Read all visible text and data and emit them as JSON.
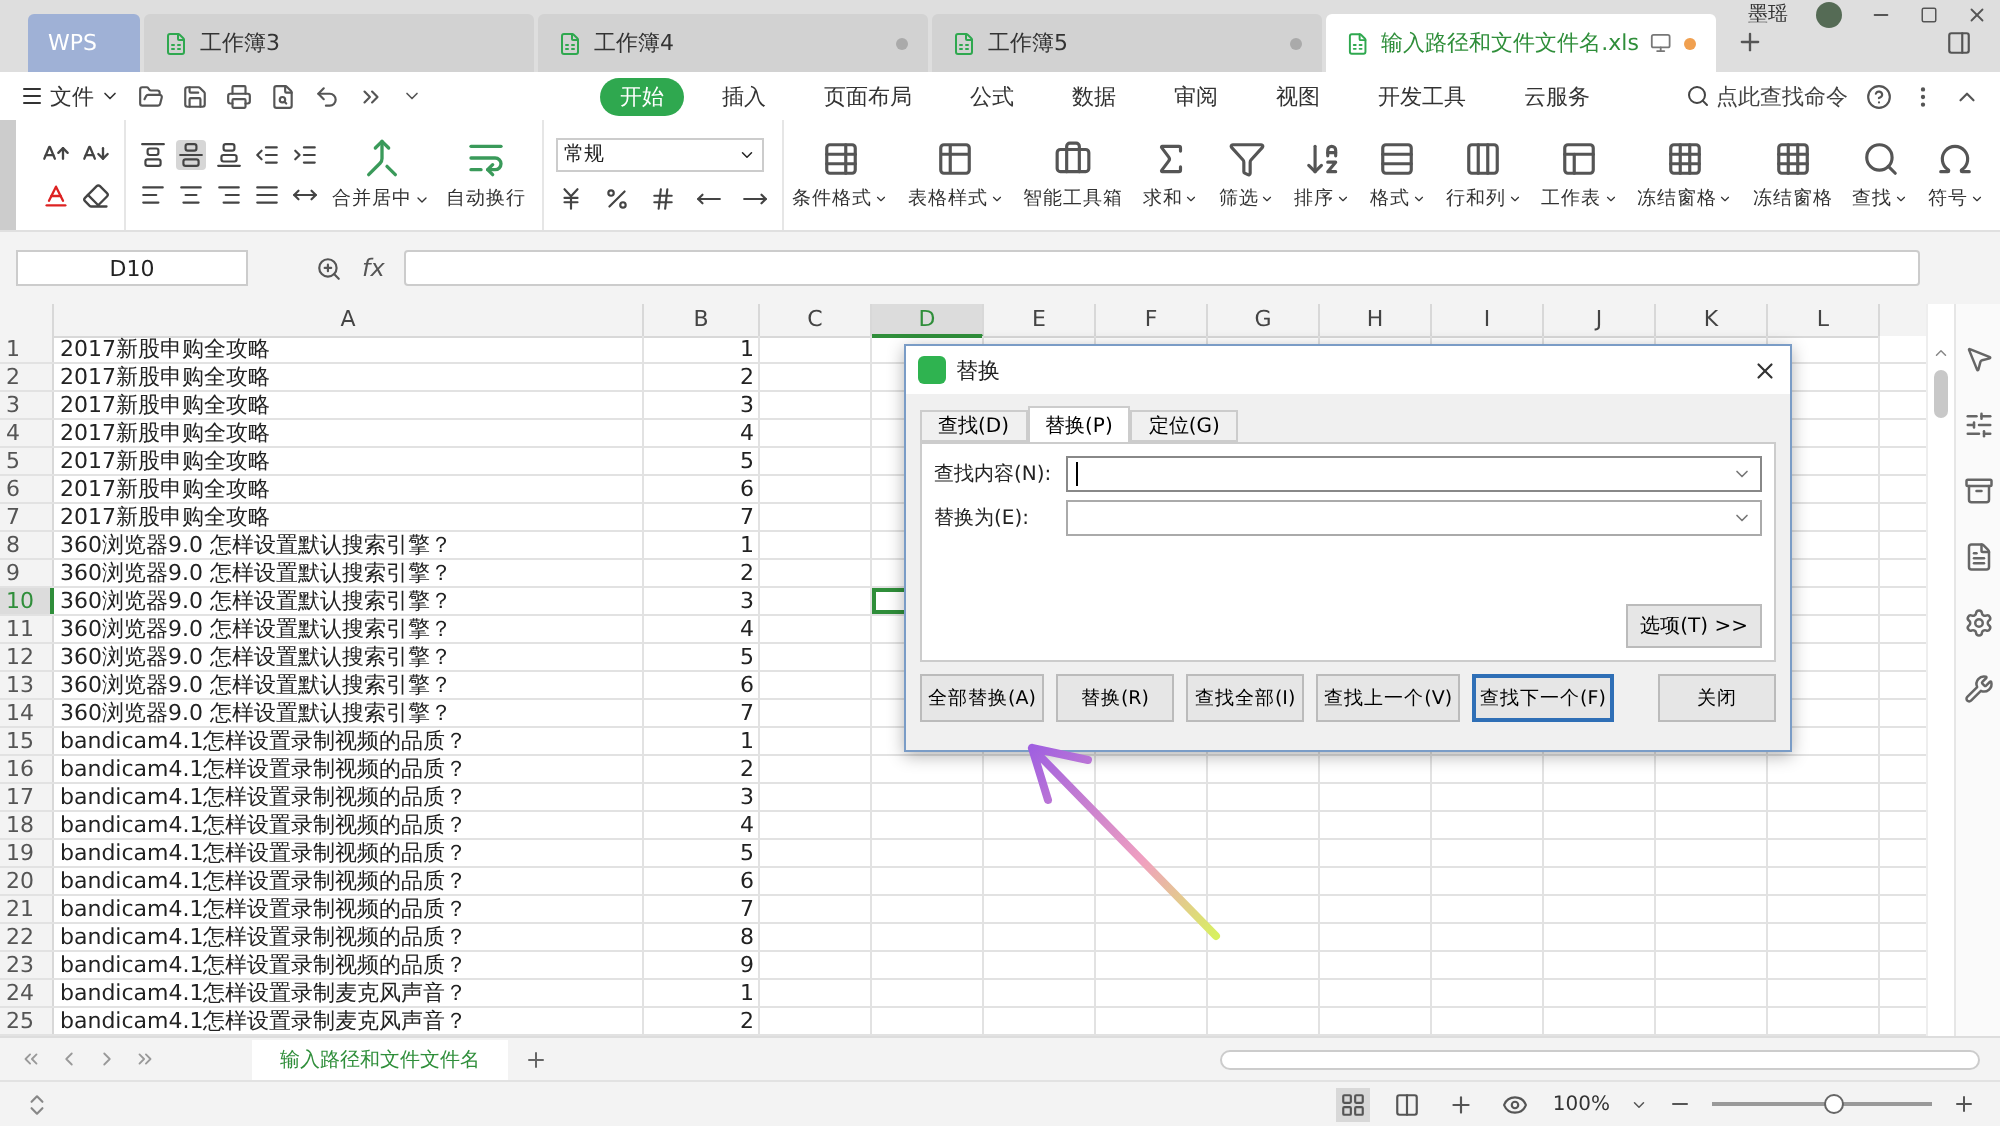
{
  "app_tabs": [
    {
      "kind": "brand",
      "label": "WPS",
      "selected": false,
      "modified": false
    },
    {
      "kind": "doc",
      "label": "工作簿3",
      "selected": false,
      "modified": false
    },
    {
      "kind": "doc",
      "label": "工作簿4",
      "selected": false,
      "modified": true
    },
    {
      "kind": "doc",
      "label": "工作簿5",
      "selected": false,
      "modified": true
    },
    {
      "kind": "doc",
      "label": "输入路径和文件文件名.xls",
      "selected": true,
      "modified": true
    }
  ],
  "user": "墨瑶",
  "menu": {
    "file": "文件",
    "tabs": [
      {
        "label": "开始",
        "selected": true
      },
      {
        "label": "插入",
        "selected": false
      },
      {
        "label": "页面布局",
        "selected": false
      },
      {
        "label": "公式",
        "selected": false
      },
      {
        "label": "数据",
        "selected": false
      },
      {
        "label": "审阅",
        "selected": false
      },
      {
        "label": "视图",
        "selected": false
      },
      {
        "label": "开发工具",
        "selected": false
      },
      {
        "label": "云服务",
        "selected": false
      }
    ],
    "search": "点此查找命令"
  },
  "ribbon": {
    "vertical_align": [
      {
        "selected": false
      },
      {
        "selected": true
      },
      {
        "selected": false
      }
    ],
    "merge": [
      {
        "label": "合并居中",
        "dropdown": true
      },
      {
        "label": "自动换行",
        "dropdown": false
      }
    ],
    "number_format": "常规",
    "commands": [
      {
        "label": "条件格式",
        "dropdown": true
      },
      {
        "label": "表格样式",
        "dropdown": true
      },
      {
        "label": "智能工具箱",
        "dropdown": false
      },
      {
        "label": "求和",
        "dropdown": true
      },
      {
        "label": "筛选",
        "dropdown": true
      },
      {
        "label": "排序",
        "dropdown": true
      },
      {
        "label": "格式",
        "dropdown": true
      },
      {
        "label": "行和列",
        "dropdown": true
      },
      {
        "label": "工作表",
        "dropdown": true
      },
      {
        "label": "冻结窗格",
        "dropdown": true
      },
      {
        "label": "冻结窗格",
        "dropdown": false
      },
      {
        "label": "查找",
        "dropdown": true
      },
      {
        "label": "符号",
        "dropdown": true
      }
    ]
  },
  "formula_bar": {
    "name_box": "D10",
    "fx": "fx"
  },
  "columns": [
    {
      "label": "A",
      "selected": false
    },
    {
      "label": "B",
      "selected": false
    },
    {
      "label": "C",
      "selected": false
    },
    {
      "label": "D",
      "selected": true
    },
    {
      "label": "E",
      "selected": false
    },
    {
      "label": "F",
      "selected": false
    },
    {
      "label": "G",
      "selected": false
    },
    {
      "label": "H",
      "selected": false
    },
    {
      "label": "I",
      "selected": false
    },
    {
      "label": "J",
      "selected": false
    },
    {
      "label": "K",
      "selected": false
    },
    {
      "label": "L",
      "selected": false
    }
  ],
  "rows": [
    {
      "number": "1",
      "a": "2017新股申购全攻略",
      "b": "1",
      "selected": false
    },
    {
      "number": "2",
      "a": "2017新股申购全攻略",
      "b": "2",
      "selected": false
    },
    {
      "number": "3",
      "a": "2017新股申购全攻略",
      "b": "3",
      "selected": false
    },
    {
      "number": "4",
      "a": "2017新股申购全攻略",
      "b": "4",
      "selected": false
    },
    {
      "number": "5",
      "a": "2017新股申购全攻略",
      "b": "5",
      "selected": false
    },
    {
      "number": "6",
      "a": "2017新股申购全攻略",
      "b": "6",
      "selected": false
    },
    {
      "number": "7",
      "a": "2017新股申购全攻略",
      "b": "7",
      "selected": false
    },
    {
      "number": "8",
      "a": "360浏览器9.0 怎样设置默认搜索引擎？",
      "b": "1",
      "selected": false
    },
    {
      "number": "9",
      "a": "360浏览器9.0 怎样设置默认搜索引擎？",
      "b": "2",
      "selected": false
    },
    {
      "number": "10",
      "a": "360浏览器9.0 怎样设置默认搜索引擎？",
      "b": "3",
      "selected": true
    },
    {
      "number": "11",
      "a": "360浏览器9.0 怎样设置默认搜索引擎？",
      "b": "4",
      "selected": false
    },
    {
      "number": "12",
      "a": "360浏览器9.0 怎样设置默认搜索引擎？",
      "b": "5",
      "selected": false
    },
    {
      "number": "13",
      "a": "360浏览器9.0 怎样设置默认搜索引擎？",
      "b": "6",
      "selected": false
    },
    {
      "number": "14",
      "a": "360浏览器9.0 怎样设置默认搜索引擎？",
      "b": "7",
      "selected": false
    },
    {
      "number": "15",
      "a": "bandicam4.1怎样设置录制视频的品质？",
      "b": "1",
      "selected": false
    },
    {
      "number": "16",
      "a": "bandicam4.1怎样设置录制视频的品质？",
      "b": "2",
      "selected": false
    },
    {
      "number": "17",
      "a": "bandicam4.1怎样设置录制视频的品质？",
      "b": "3",
      "selected": false
    },
    {
      "number": "18",
      "a": "bandicam4.1怎样设置录制视频的品质？",
      "b": "4",
      "selected": false
    },
    {
      "number": "19",
      "a": "bandicam4.1怎样设置录制视频的品质？",
      "b": "5",
      "selected": false
    },
    {
      "number": "20",
      "a": "bandicam4.1怎样设置录制视频的品质？",
      "b": "6",
      "selected": false
    },
    {
      "number": "21",
      "a": "bandicam4.1怎样设置录制视频的品质？",
      "b": "7",
      "selected": false
    },
    {
      "number": "22",
      "a": "bandicam4.1怎样设置录制视频的品质？",
      "b": "8",
      "selected": false
    },
    {
      "number": "23",
      "a": "bandicam4.1怎样设置录制视频的品质？",
      "b": "9",
      "selected": false
    },
    {
      "number": "24",
      "a": "bandicam4.1怎样设置录制麦克风声音？",
      "b": "1",
      "selected": false
    },
    {
      "number": "25",
      "a": "bandicam4.1怎样设置录制麦克风声音？",
      "b": "2",
      "selected": false
    }
  ],
  "sheet_tabs": [
    {
      "label": "输入路径和文件文件名",
      "selected": true
    }
  ],
  "status_bar": {
    "zoom": "100%",
    "level": 0.55
  },
  "dialog": {
    "title": "替换",
    "tabs": [
      {
        "label": "查找(D)",
        "selected": false
      },
      {
        "label": "替换(P)",
        "selected": true
      },
      {
        "label": "定位(G)",
        "selected": false
      }
    ],
    "fields": [
      {
        "label": "查找内容(N):",
        "focused": true
      },
      {
        "label": "替换为(E):",
        "focused": false
      }
    ],
    "options": "选项(T) >>",
    "buttons": [
      {
        "label": "全部替换(A)",
        "default": false
      },
      {
        "label": "替换(R)",
        "default": false
      },
      {
        "label": "查找全部(I)",
        "default": false
      },
      {
        "label": "查找上一个(V)",
        "default": false
      },
      {
        "label": "查找下一个(F)",
        "default": true
      },
      {
        "label": "关闭",
        "default": false
      }
    ]
  }
}
